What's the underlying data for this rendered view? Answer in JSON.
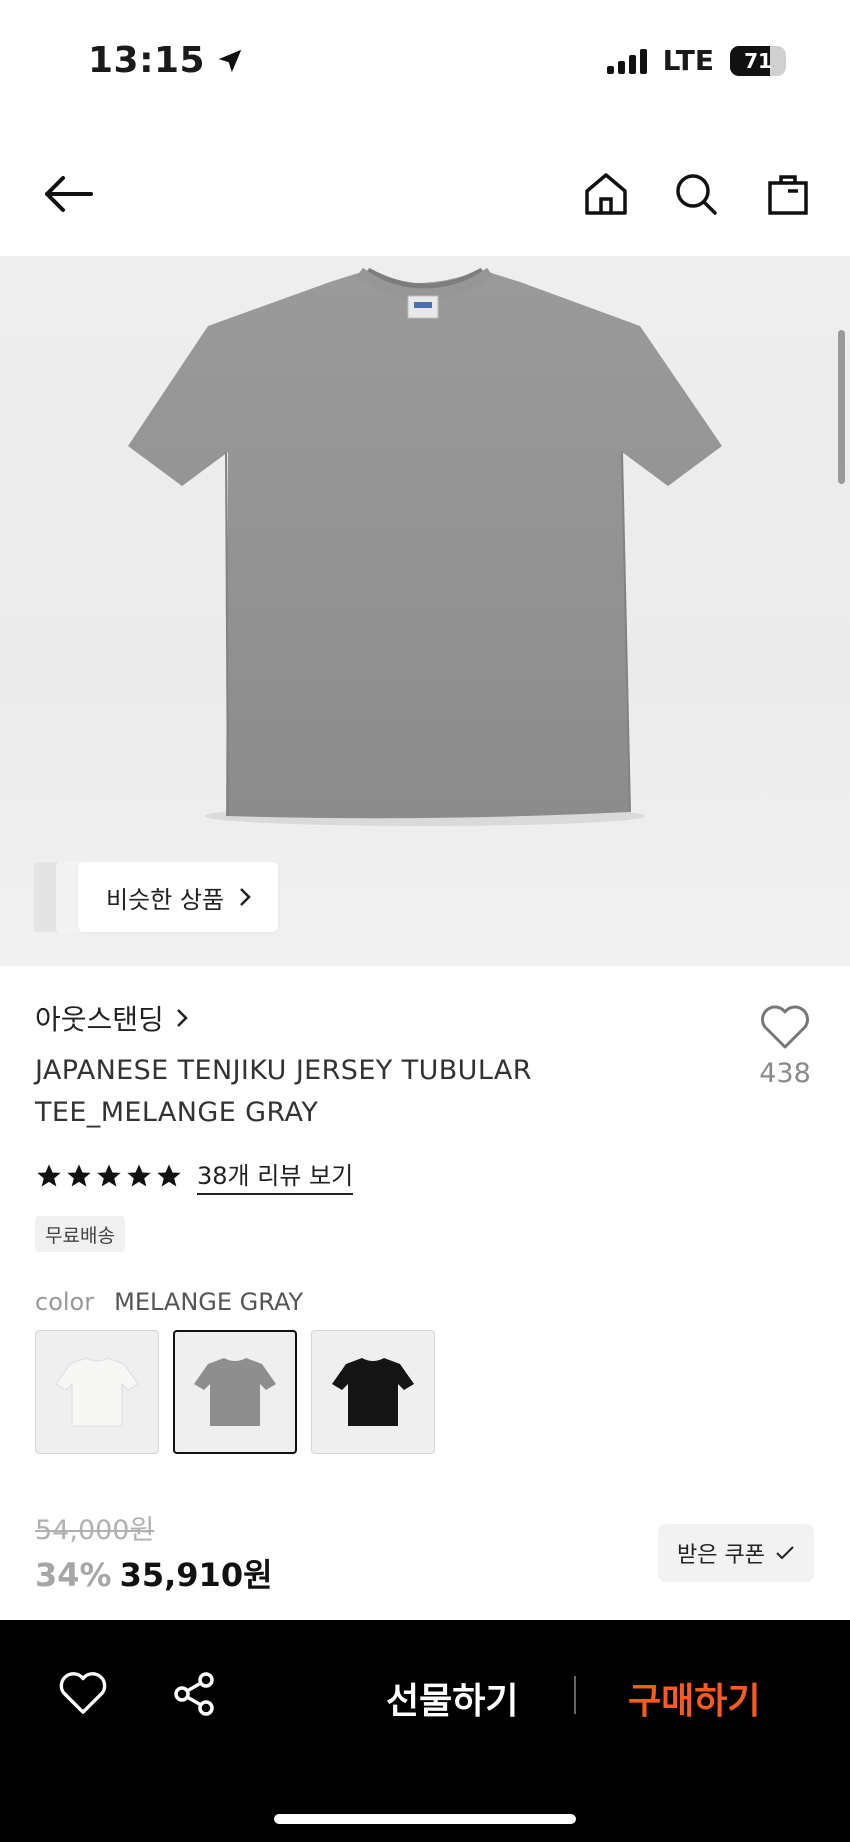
{
  "status_bar": {
    "time": "13:15",
    "network": "LTE",
    "battery_level": "71"
  },
  "nav": {
    "back_icon": "arrow-left-icon",
    "home_icon": "home-icon",
    "search_icon": "search-icon",
    "cart_icon": "shopping-bag-icon"
  },
  "hero": {
    "image": "gray-tshirt-photo",
    "similar_label": "비슷한 상품"
  },
  "product": {
    "brand": "아웃스탠딩",
    "title_line1": "JAPANESE TENJIKU JERSEY TUBULAR",
    "title_line2": "TEE_MELANGE GRAY",
    "like_count": "438",
    "rating_stars": 5,
    "review_link": "38개 리뷰 보기",
    "badge": "무료배송",
    "color_label": "color",
    "color_value": "MELANGE GRAY",
    "swatches": [
      {
        "name": "white",
        "color": "#f4f4f2",
        "selected": false
      },
      {
        "name": "melange-gray",
        "color": "#8e8e8e",
        "selected": true
      },
      {
        "name": "black",
        "color": "#151515",
        "selected": false
      }
    ]
  },
  "price": {
    "original": "54,000원",
    "discount": "34%",
    "final": "35,910원",
    "coupon_label": "받은 쿠폰"
  },
  "bottom_bar": {
    "gift_label": "선물하기",
    "buy_label": "구매하기",
    "buy_color": "#ff5a1f"
  }
}
